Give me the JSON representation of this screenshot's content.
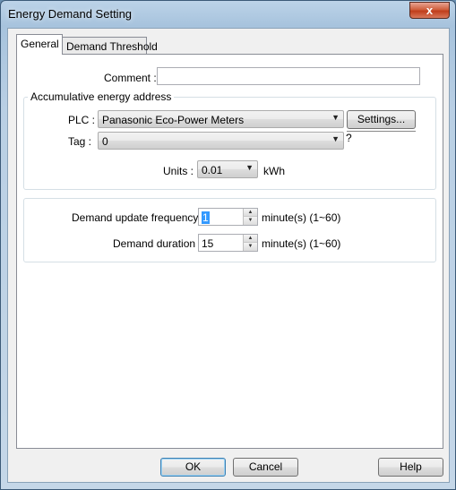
{
  "window": {
    "title": "Energy Demand Setting",
    "close_glyph": "x"
  },
  "tabs": [
    {
      "label": "General"
    },
    {
      "label": "Demand Threshold"
    }
  ],
  "general": {
    "comment_label": "Comment :",
    "comment_value": "",
    "address_group_title": "Accumulative energy address",
    "plc_label": "PLC :",
    "plc_value": "Panasonic Eco-Power Meters",
    "settings_button": "Settings...",
    "tag_label": "Tag :",
    "tag_value": "0",
    "tag_help": "?",
    "units_label": "Units :",
    "units_value": "0.01",
    "units_suffix": "kWh",
    "update_freq_label": "Demand update frequency :",
    "update_freq_value": "1",
    "update_freq_suffix": "minute(s) (1~60)",
    "duration_label": "Demand duration :",
    "duration_value": "15",
    "duration_suffix": "minute(s) (1~60)"
  },
  "footer": {
    "ok": "OK",
    "cancel": "Cancel",
    "help": "Help"
  },
  "icons": {
    "dropdown": "chevron-down-icon",
    "spin_up": "spin-up-icon",
    "spin_down": "spin-down-icon",
    "close": "close-icon"
  }
}
